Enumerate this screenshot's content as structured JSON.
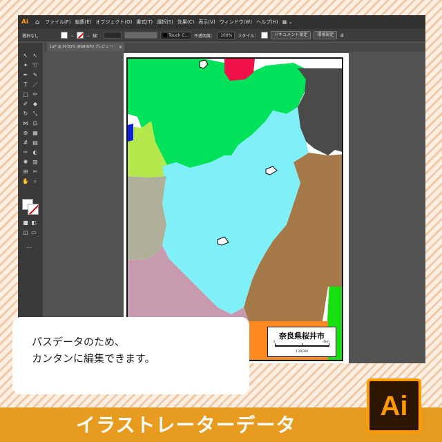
{
  "menubar": {
    "logo": "Ai",
    "items": [
      "ファイル(F)",
      "編集(E)",
      "オブジェクト(O)",
      "書式(T)",
      "選択(S)",
      "効果(C)",
      "表示(V)",
      "ウィンドウ(W)",
      "ヘルプ(H)"
    ],
    "workspace_icon": "layout-icon"
  },
  "optionbar": {
    "selection": "選択なし",
    "stroke_label": "線：",
    "brush": "Touch C...",
    "opacity_label": "不透明度：",
    "opacity_value": "100%",
    "style_label": "スタイル：",
    "doc_settings_button": "ドキュメント設定",
    "preferences_button": "環境設定"
  },
  "document_tab": {
    "title": "1ai* @ 30.52% (RGB/GPU プレビュー)",
    "close": "×"
  },
  "map": {
    "scale_title": "奈良県桜井市",
    "scale_labels": [
      "0",
      "4km"
    ],
    "scale_ratio": "1:29,000",
    "colors": {
      "green": "#00e25a",
      "red": "#f0104a",
      "dark_gray": "#4a4a4a",
      "light_cyan": "#7ff0f8",
      "lime": "#b4e84c",
      "khaki": "#b0b09a",
      "brown": "#a57a48",
      "mauve": "#c89ab0",
      "bright_green": "#16e010",
      "orange": "#ff8820",
      "blue": "#1020e0"
    }
  },
  "callout": {
    "text": "パスデータのため、\nカンタンに編集できます。"
  },
  "banner": {
    "text": "イラストレーターデータ",
    "logo": "Ai"
  }
}
